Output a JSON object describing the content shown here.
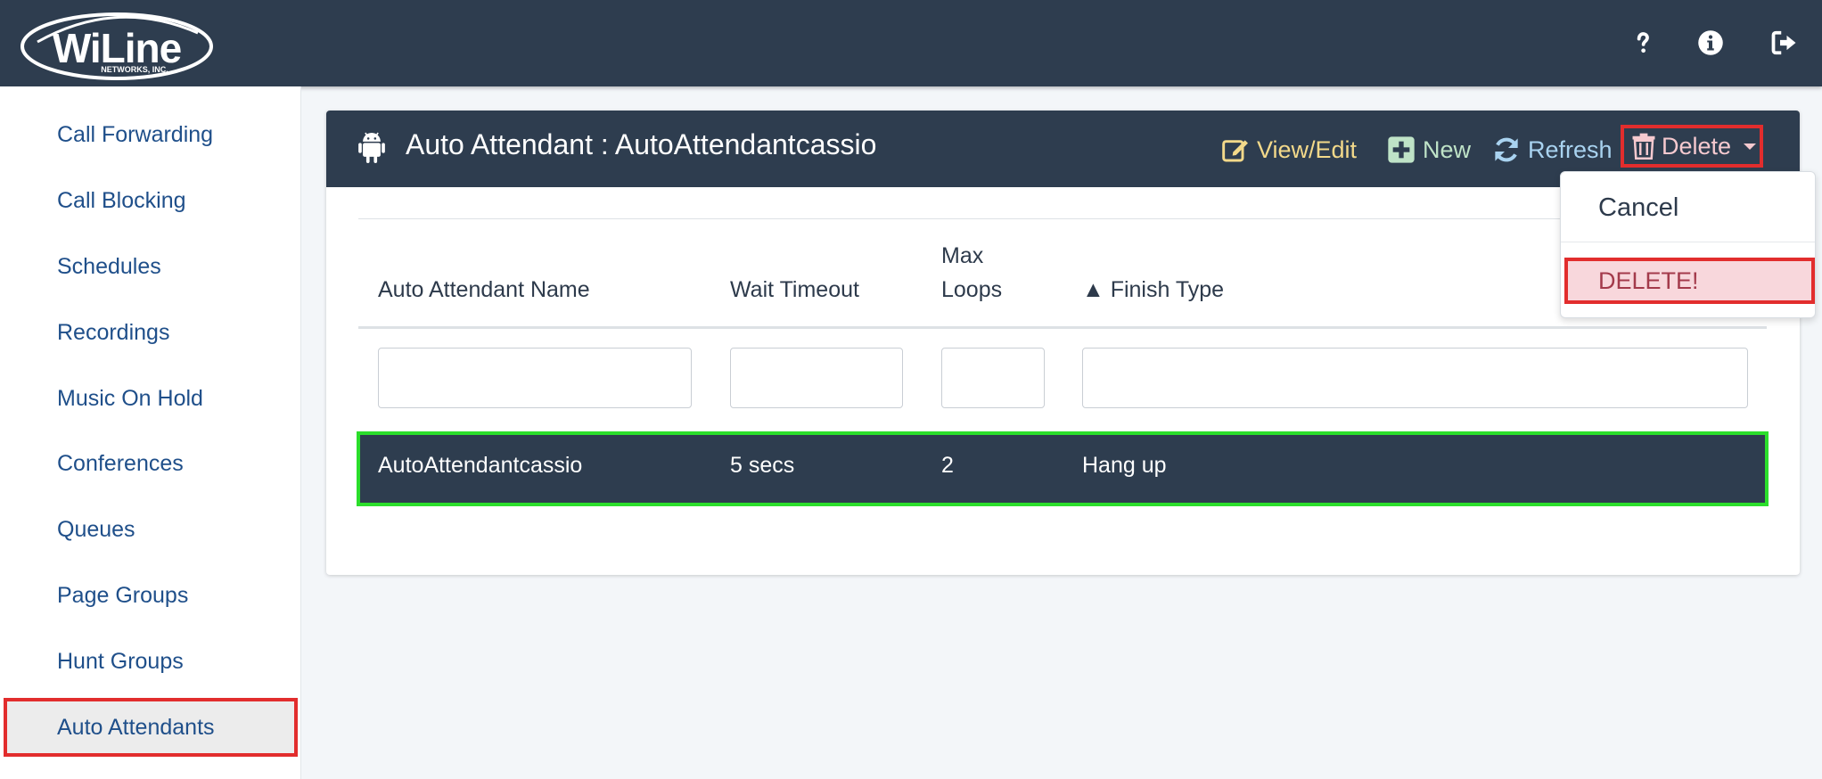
{
  "brand": {
    "name": "WiLine",
    "subtitle": "NETWORKS, INC."
  },
  "topbar": {
    "icons": [
      "help-icon",
      "info-icon",
      "logout-icon"
    ]
  },
  "sidebar": {
    "items": [
      {
        "label": "Call Forwarding"
      },
      {
        "label": "Call Blocking"
      },
      {
        "label": "Schedules"
      },
      {
        "label": "Recordings"
      },
      {
        "label": "Music On Hold"
      },
      {
        "label": "Conferences"
      },
      {
        "label": "Queues"
      },
      {
        "label": "Page Groups"
      },
      {
        "label": "Hunt Groups"
      },
      {
        "label": "Auto Attendants"
      }
    ],
    "active": "Auto Attendants"
  },
  "card": {
    "title": "Auto Attendant : AutoAttendantcassio",
    "actions": {
      "view_edit": "View/Edit",
      "new": "New",
      "refresh": "Refresh",
      "delete": "Delete"
    }
  },
  "table": {
    "headers": {
      "name": "Auto Attendant Name",
      "wait_timeout": "Wait Timeout",
      "max_loops_1": "Max",
      "max_loops_2": "Loops",
      "finish_type": "▲ Finish Type"
    },
    "filters": {
      "name": "",
      "wait_timeout": "",
      "max_loops": "",
      "finish_type": ""
    },
    "rows": [
      {
        "name": "AutoAttendantcassio",
        "wait_timeout": "5 secs",
        "max_loops": "2",
        "finish_type": "Hang up"
      }
    ]
  },
  "dropdown": {
    "cancel": "Cancel",
    "confirm": "DELETE!"
  },
  "colors": {
    "header_bg": "#2e3d4f",
    "highlight_red": "#e22d2d",
    "selected_green": "#2bde2b",
    "link_blue": "#1f4f8a"
  }
}
